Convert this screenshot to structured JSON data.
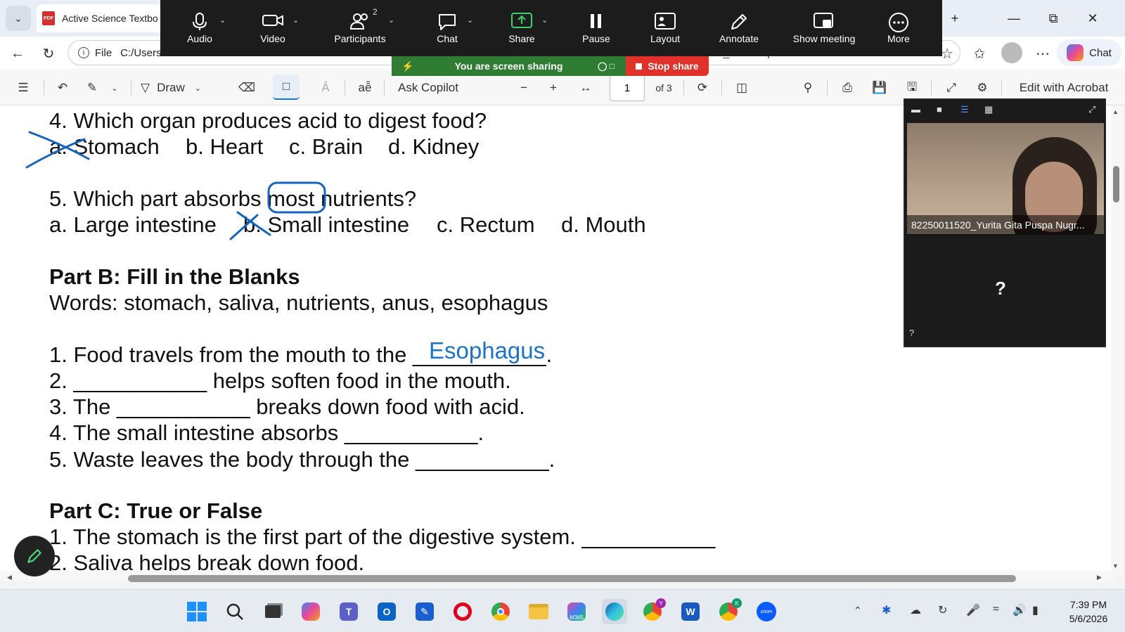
{
  "browser": {
    "tab_title": "Active Science Textbo",
    "pdf_badge": "PDF",
    "url_prefix": "File",
    "url_visible": "C:/Users",
    "url_tail": "ct_Grade6.pdf",
    "chat_label": "Chat"
  },
  "zoom_toolbar": {
    "items": [
      {
        "label": "Audio",
        "icon": "microphone-icon"
      },
      {
        "label": "Video",
        "icon": "video-camera-icon"
      },
      {
        "label": "Participants",
        "icon": "participants-icon",
        "count": "2"
      },
      {
        "label": "Chat",
        "icon": "chat-bubble-icon"
      },
      {
        "label": "Share",
        "icon": "share-screen-icon"
      },
      {
        "label": "Pause",
        "icon": "pause-icon"
      },
      {
        "label": "Layout",
        "icon": "layout-icon"
      },
      {
        "label": "Annotate",
        "icon": "pencil-icon"
      },
      {
        "label": "Show meeting",
        "icon": "show-meeting-icon"
      },
      {
        "label": "More",
        "icon": "more-icon"
      }
    ],
    "sharing_banner": "You are screen sharing",
    "stop_share": "Stop share"
  },
  "pdf_toolbar": {
    "draw_label": "Draw",
    "ask_copilot": "Ask Copilot",
    "page_current": "1",
    "page_total": "of 3",
    "edit_acrobat": "Edit with Acrobat"
  },
  "document": {
    "q4": "4. Which organ produces acid to digest food?",
    "q4_a": "a. Stomach",
    "q4_b": "b. Heart",
    "q4_c": "c. Brain",
    "q4_d": "d. Kidney",
    "q5_pre": "5. Which part absorbs ",
    "q5_mid": "most",
    "q5_post": " nutrients?",
    "q5_a": "a. Large intestine",
    "q5_b": "b. Small intestine",
    "q5_c": "c. Rectum",
    "q5_d": "d. Mouth",
    "partB_title": "Part B: Fill in the Blanks",
    "partB_words": "Words: stomach, saliva, nutrients, anus, esophagus",
    "b1": "1. Food travels from the mouth to the ___________.",
    "b1_answer": "Esophagus",
    "b2": "2. ___________ helps soften food in the mouth.",
    "b3": "3. The ___________ breaks down food with acid.",
    "b4": "4. The small intestine absorbs ___________.",
    "b5": "5. Waste leaves the body through the ___________.",
    "partC_title": "Part C: True or False",
    "c1": "1. The stomach is the first part of the digestive system. ___________",
    "c2": "2. Saliva helps break down food."
  },
  "video_panel": {
    "participant_name": "82250011520_Yurita Gita Puspa Nugr...",
    "placeholder": "?",
    "corner_label": "?"
  },
  "taskbar": {
    "time": "7:39 PM",
    "date": "5/6/2026",
    "apps": [
      "windows-start",
      "search",
      "task-view",
      "copilot",
      "teams",
      "outlook",
      "notepad",
      "opera",
      "chrome",
      "file-explorer",
      "m365",
      "edge",
      "chrome-profile-y",
      "word",
      "chrome-profile-k",
      "zoom"
    ]
  },
  "colors": {
    "annotation_blue": "#1565c0",
    "answer_blue": "#1a73c8",
    "share_green": "#2e7d32",
    "stop_red": "#e0322b"
  }
}
